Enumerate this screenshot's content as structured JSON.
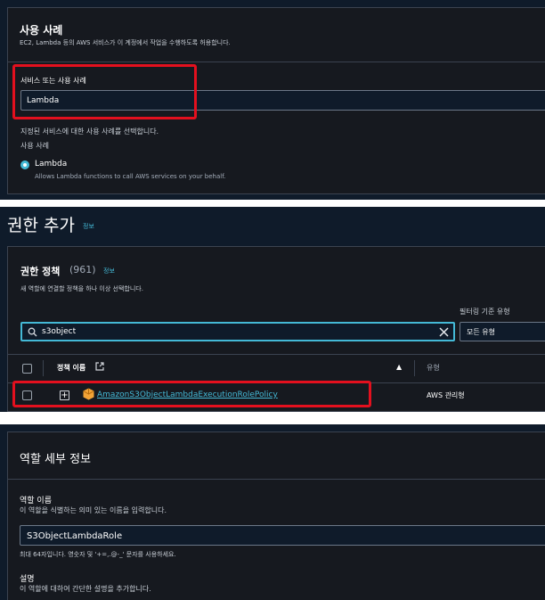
{
  "use_case": {
    "title": "사용 사례",
    "description": "EC2, Lambda 등의 AWS 서비스가 이 계정에서 작업을 수행하도록 허용합니다.",
    "field_label": "서비스 또는 사용 사례",
    "field_value": "Lambda",
    "select_hint": "지정된 서비스에 대한 사용 사례를 선택합니다.",
    "use_case_label": "사용 사례",
    "option_label": "Lambda",
    "option_desc": "Allows Lambda functions to call AWS services on your behalf."
  },
  "permissions": {
    "page_title": "권한 추가",
    "page_info": "정보",
    "policy_title": "권한 정책",
    "policy_count": "(961)",
    "policy_info": "정보",
    "policy_desc": "새 역할에 연결할 정책을 하나 이상 선택합니다.",
    "filter_label": "필터링 기준 유형",
    "search_value": "s3object",
    "filter_value": "모든 유형",
    "col_name": "정책 이름",
    "col_type": "유형",
    "rows": [
      {
        "name": "AmazonS3ObjectLambdaExecutionRolePolicy",
        "type": "AWS 관리형"
      }
    ]
  },
  "role_details": {
    "title": "역할 세부 정보",
    "name_label": "역할 이름",
    "name_hint": "이 역할을 식별하는 의미 있는 이름을 입력합니다.",
    "name_value": "S3ObjectLambdaRole",
    "name_constraint": "최대 64자입니다. 영숫자 및 '+=,.@-_' 문자를 사용하세요.",
    "desc_label": "설명",
    "desc_hint": "이 역할에 대하여 간단한 설명을 추가합니다."
  },
  "colors": {
    "accent": "#44b9d6",
    "highlight": "#e3101e",
    "panel_bg": "#0f1b2a",
    "card_bg": "#16191f"
  }
}
